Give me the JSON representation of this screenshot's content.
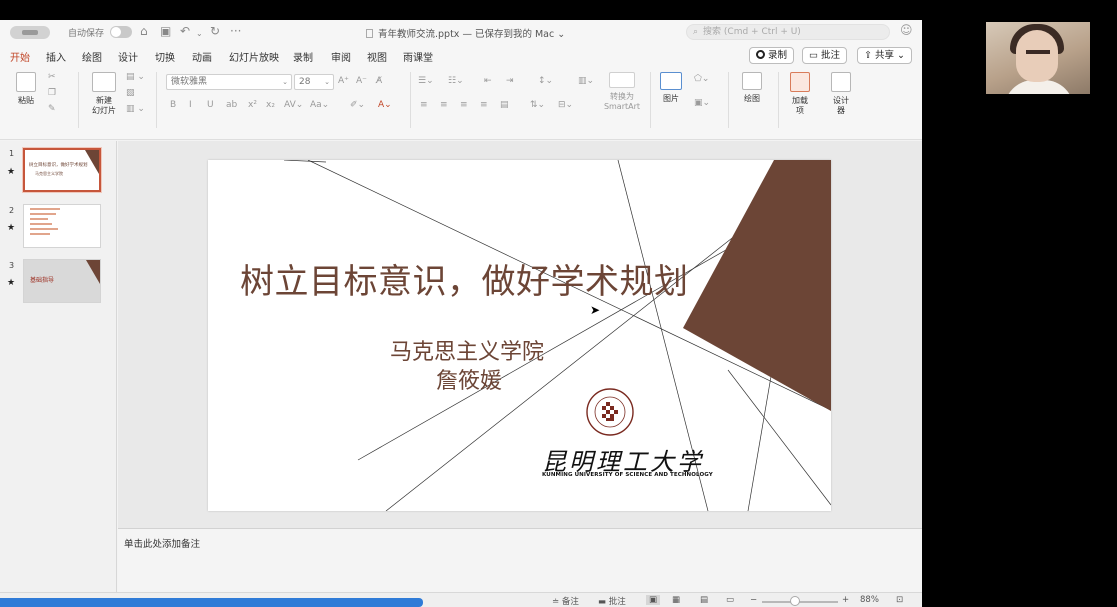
{
  "titlebar": {
    "autosave_label": "自动保存",
    "doc_title": "青年教师交流.pptx — 已保存到我的 Mac",
    "search_placeholder": "搜索 (Cmd + Ctrl + U)"
  },
  "menu": {
    "tabs": [
      "开始",
      "插入",
      "绘图",
      "设计",
      "切换",
      "动画",
      "幻灯片放映",
      "录制",
      "审阅",
      "视图",
      "雨课堂"
    ],
    "active_tab": "开始",
    "record_label": "录制",
    "comments_label": "批注",
    "share_label": "共享"
  },
  "ribbon": {
    "paste_label": "粘贴",
    "new_slide_label": "新建\n幻灯片",
    "font_name": "微软雅黑",
    "font_size": "28",
    "convert_smartart_label": "转换为\nSmartArt",
    "picture_label": "图片",
    "draw_label": "绘图",
    "addins_label": "加载\n项",
    "designer_label": "设计\n器"
  },
  "thumbnails": [
    {
      "number": "1",
      "title": "树立目标意识，做好学术规划",
      "subtitle": "马克思主义学院"
    },
    {
      "number": "2"
    },
    {
      "number": "3",
      "title": "基础指导"
    }
  ],
  "slide": {
    "title": "树立目标意识，做好学术规划",
    "subtitle": "马克思主义学院",
    "author": "詹筱媛",
    "logo_cn": "昆明理工大学",
    "logo_en": "KUNMING UNIVERSITY OF SCIENCE AND TECHNOLOGY",
    "accent_color": "#6c4536"
  },
  "notes": {
    "placeholder": "单击此处添加备注"
  },
  "statusbar": {
    "notes_label": "备注",
    "comments_label": "批注",
    "zoom": "88%",
    "zoom_minus": "−",
    "zoom_plus": "+"
  },
  "colors": {
    "active_tab": "#c2482a",
    "progress": "#2f7bd7",
    "slide_brown": "#6c4536"
  }
}
